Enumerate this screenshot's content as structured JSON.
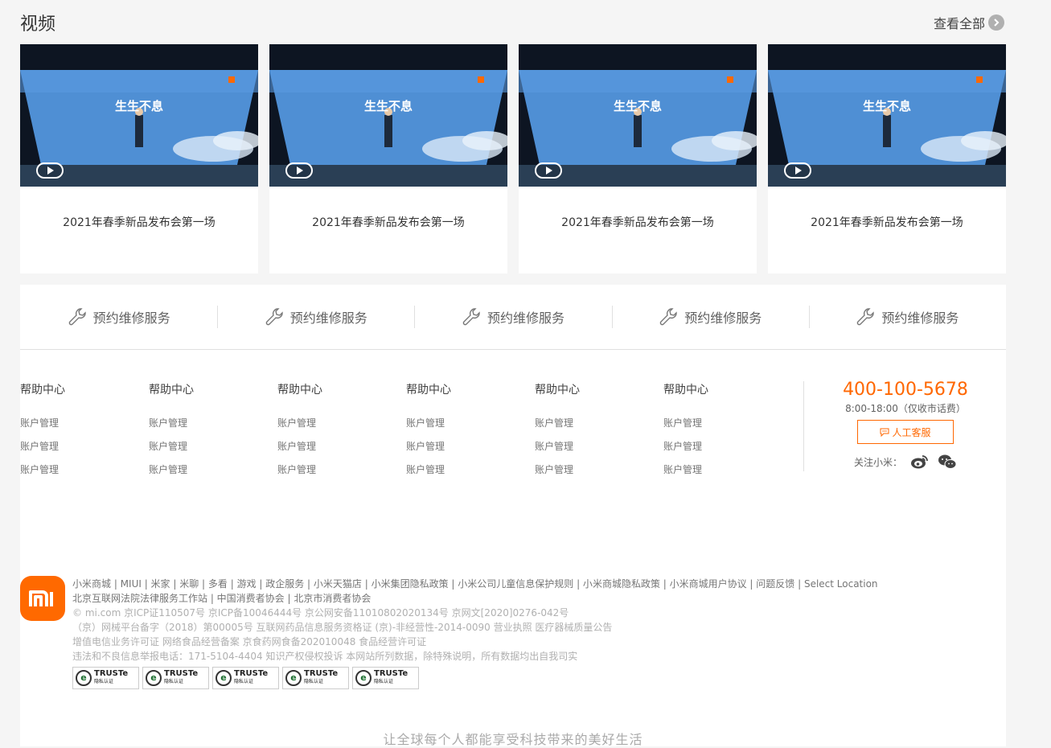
{
  "section": {
    "title": "视频",
    "view_all": "查看全部"
  },
  "videos": [
    {
      "title": "2021年春季新品发布会第一场",
      "banner_text": "生生不息"
    },
    {
      "title": "2021年春季新品发布会第一场",
      "banner_text": "生生不息"
    },
    {
      "title": "2021年春季新品发布会第一场",
      "banner_text": "生生不息"
    },
    {
      "title": "2021年春季新品发布会第一场",
      "banner_text": "生生不息"
    }
  ],
  "services": [
    {
      "label": "预约维修服务",
      "icon": "wrench-icon"
    },
    {
      "label": "预约维修服务",
      "icon": "wrench-icon"
    },
    {
      "label": "预约维修服务",
      "icon": "wrench-icon"
    },
    {
      "label": "预约维修服务",
      "icon": "wrench-icon"
    },
    {
      "label": "预约维修服务",
      "icon": "wrench-icon"
    }
  ],
  "link_columns": [
    {
      "heading": "帮助中心",
      "links": [
        "账户管理",
        "账户管理",
        "账户管理"
      ]
    },
    {
      "heading": "帮助中心",
      "links": [
        "账户管理",
        "账户管理",
        "账户管理"
      ]
    },
    {
      "heading": "帮助中心",
      "links": [
        "账户管理",
        "账户管理",
        "账户管理"
      ]
    },
    {
      "heading": "帮助中心",
      "links": [
        "账户管理",
        "账户管理",
        "账户管理"
      ]
    },
    {
      "heading": "帮助中心",
      "links": [
        "账户管理",
        "账户管理",
        "账户管理"
      ]
    },
    {
      "heading": "帮助中心",
      "links": [
        "账户管理",
        "账户管理",
        "账户管理"
      ]
    }
  ],
  "contact": {
    "phone": "400-100-5678",
    "hours": "8:00-18:00（仅收市话费）",
    "cs_button": "人工客服",
    "follow_label": "关注小米："
  },
  "legal": {
    "logo_text": "mi",
    "line1": "小米商城 | MIUI | 米家 | 米聊 | 多看 | 游戏 | 政企服务 | 小米天猫店 | 小米集团隐私政策 | 小米公司儿童信息保护规则 | 小米商城隐私政策 | 小米商城用户协议 | 问题反馈 | Select Location",
    "line2": "北京互联网法院法律服务工作站 | 中国消费者协会 | 北京市消费者协会",
    "line3": "© mi.com 京ICP证110507号 京ICP备10046444号 京公网安备11010802020134号 京网文[2020]0276-042号",
    "line4": "（京）网械平台备字（2018）第00005号 互联网药品信息服务资格证 (京)-非经营性-2014-0090 营业执照 医疗器械质量公告",
    "line5": "增值电信业务许可证 网络食品经营备案 京食药网食备202010048   食品经营许可证",
    "line6": "违法和不良信息举报电话：171-5104-4404 知识产权侵权投诉 本网站所列数据，除特殊说明，所有数据均出自我司实",
    "badges": [
      {
        "name": "TRUSTe",
        "sub": "隐私认证"
      },
      {
        "name": "TRUSTe",
        "sub": "隐私认证"
      },
      {
        "name": "TRUSTe",
        "sub": "隐私认证"
      },
      {
        "name": "TRUSTe",
        "sub": "隐私认证"
      },
      {
        "name": "TRUSTe",
        "sub": "隐私认证"
      }
    ]
  },
  "slogan": "让全球每个人都能享受科技带来的美好生活",
  "colors": {
    "accent": "#ff6700",
    "logo": "#ff6900",
    "background": "#f5f5f5"
  }
}
